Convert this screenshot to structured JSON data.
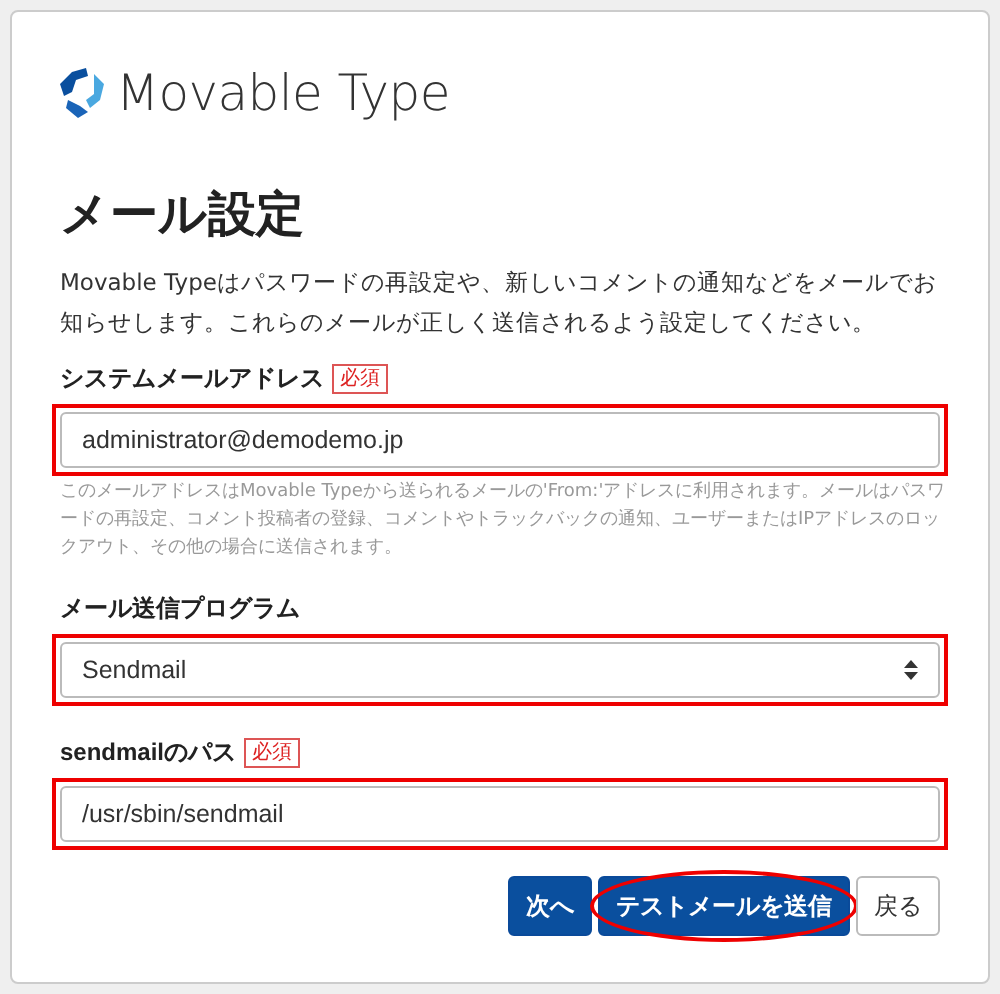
{
  "logo": {
    "text": "Movable Type"
  },
  "heading": "メール設定",
  "intro": "Movable Typeはパスワードの再設定や、新しいコメントの通知などをメールでお知らせします。これらのメールが正しく送信されるよう設定してください。",
  "fields": [
    {
      "kind": "text",
      "label": "システムメールアドレス",
      "required": true,
      "required_badge": "必須",
      "value": "administrator@demodemo.jp",
      "highlighted": true,
      "hint": "このメールアドレスはMovable Typeから送られるメールの'From:'アドレスに利用されます。メールはパスワードの再設定、コメント投稿者の登録、コメントやトラックバックの通知、ユーザーまたはIPアドレスのロックアウト、その他の場合に送信されます。"
    },
    {
      "kind": "select",
      "label": "メール送信プログラム",
      "required": false,
      "value": "Sendmail",
      "highlighted": true
    },
    {
      "kind": "text",
      "label": "sendmailのパス",
      "required": true,
      "required_badge": "必須",
      "value": "/usr/sbin/sendmail",
      "highlighted": true
    }
  ],
  "buttons": [
    {
      "label": "次へ",
      "kind": "primary",
      "highlighted": false
    },
    {
      "label": "テストメールを送信",
      "kind": "primary",
      "highlighted": true
    },
    {
      "label": "戻る",
      "kind": "secondary",
      "highlighted": false
    }
  ]
}
